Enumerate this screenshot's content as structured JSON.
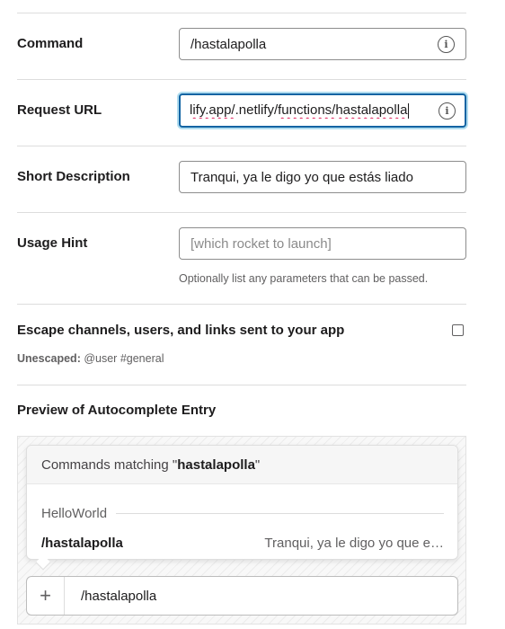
{
  "form": {
    "command": {
      "label": "Command",
      "value": "/hastalapolla"
    },
    "request_url": {
      "label": "Request URL",
      "value_prefix": "lify.app/",
      "value_mid1": ".netlify/",
      "value_mid2": "functions/",
      "value_end": "hastalapolla"
    },
    "short_description": {
      "label": "Short Description",
      "value": "Tranqui, ya le digo yo que estás liado"
    },
    "usage_hint": {
      "label": "Usage Hint",
      "placeholder": "[which rocket to launch]",
      "help": "Optionally list any parameters that can be passed."
    },
    "escape": {
      "label": "Escape channels, users, and links sent to your app",
      "checked": false,
      "unescaped_label": "Unescaped:",
      "unescaped_example": "@user #general"
    }
  },
  "preview": {
    "title": "Preview of Autocomplete Entry",
    "header_prefix": "Commands matching \"",
    "header_query": "hastalapolla",
    "header_suffix": "\"",
    "group_name": "HelloWorld",
    "entry_command": "/hastalapolla",
    "entry_description": "Tranqui, ya le digo yo que e…",
    "composer_plus": "+",
    "composer_text": "/hastalapolla"
  },
  "icons": {
    "info": "info-icon",
    "plus": "plus-icon"
  },
  "colors": {
    "focus_border": "#1264a3",
    "spellcheck_underline": "#e01e5a"
  }
}
